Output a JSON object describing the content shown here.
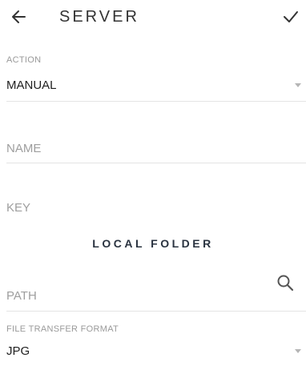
{
  "header": {
    "back_icon": "arrow-left-icon",
    "title": "SERVER",
    "confirm_icon": "checkmark-icon"
  },
  "action": {
    "label": "ACTION",
    "value": "MANUAL"
  },
  "name_field": {
    "placeholder": "NAME",
    "value": ""
  },
  "key_field": {
    "placeholder": "KEY",
    "value": ""
  },
  "local_folder": {
    "title": "LOCAL FOLDER",
    "path_placeholder": "PATH",
    "path_value": "",
    "search_icon": "search-icon"
  },
  "file_transfer_format": {
    "label": "FILE TRANSFER FORMAT",
    "value": "JPG"
  },
  "colors": {
    "text": "#222222",
    "muted": "#9a9a9a",
    "divider": "#e4e4e4",
    "section_title": "#2a3340"
  }
}
